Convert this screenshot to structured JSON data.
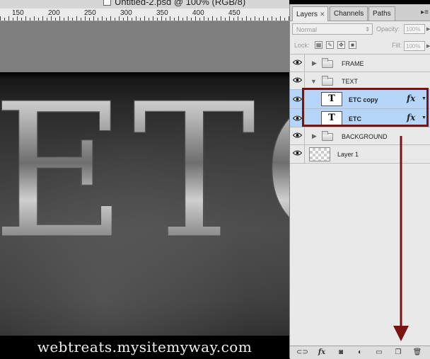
{
  "document": {
    "title": "Untitled-2.psd @ 100% (RGB/8)"
  },
  "ruler": {
    "labels": [
      "150",
      "200",
      "250",
      "300",
      "350",
      "400",
      "450"
    ]
  },
  "artwork": {
    "headline": "ETC",
    "watermark": "webtreats.mysitemyway.com"
  },
  "layers_panel": {
    "tabs": [
      {
        "label": "Layers",
        "active": true
      },
      {
        "label": "Channels",
        "active": false
      },
      {
        "label": "Paths",
        "active": false
      }
    ],
    "blend_mode": "Normal",
    "opacity_label": "Opacity:",
    "opacity_value": "100%",
    "lock_label": "Lock:",
    "fill_label": "Fill:",
    "fill_value": "100%",
    "layers": [
      {
        "name": "FRAME",
        "type": "group",
        "expanded": false,
        "visible": true,
        "selected": false
      },
      {
        "name": "TEXT",
        "type": "group",
        "expanded": true,
        "visible": true,
        "selected": false
      },
      {
        "name": "ETC copy",
        "type": "text",
        "thumb": "T",
        "fx": "fx",
        "visible": true,
        "selected": true
      },
      {
        "name": "ETC",
        "type": "text",
        "thumb": "T",
        "fx": "fx",
        "visible": true,
        "selected": true
      },
      {
        "name": "BACKGROUND",
        "type": "group",
        "expanded": false,
        "visible": true,
        "selected": false
      },
      {
        "name": "Layer 1",
        "type": "pixel",
        "visible": true,
        "selected": false
      }
    ],
    "bottom_icons": [
      "link-icon",
      "fx-icon",
      "mask-icon",
      "adjustment-icon",
      "new-group-icon",
      "new-layer-icon",
      "trash-icon"
    ],
    "bottom_fx": "fx"
  },
  "colors": {
    "selection": "#b5d5fb",
    "annotation": "#7d1212"
  }
}
